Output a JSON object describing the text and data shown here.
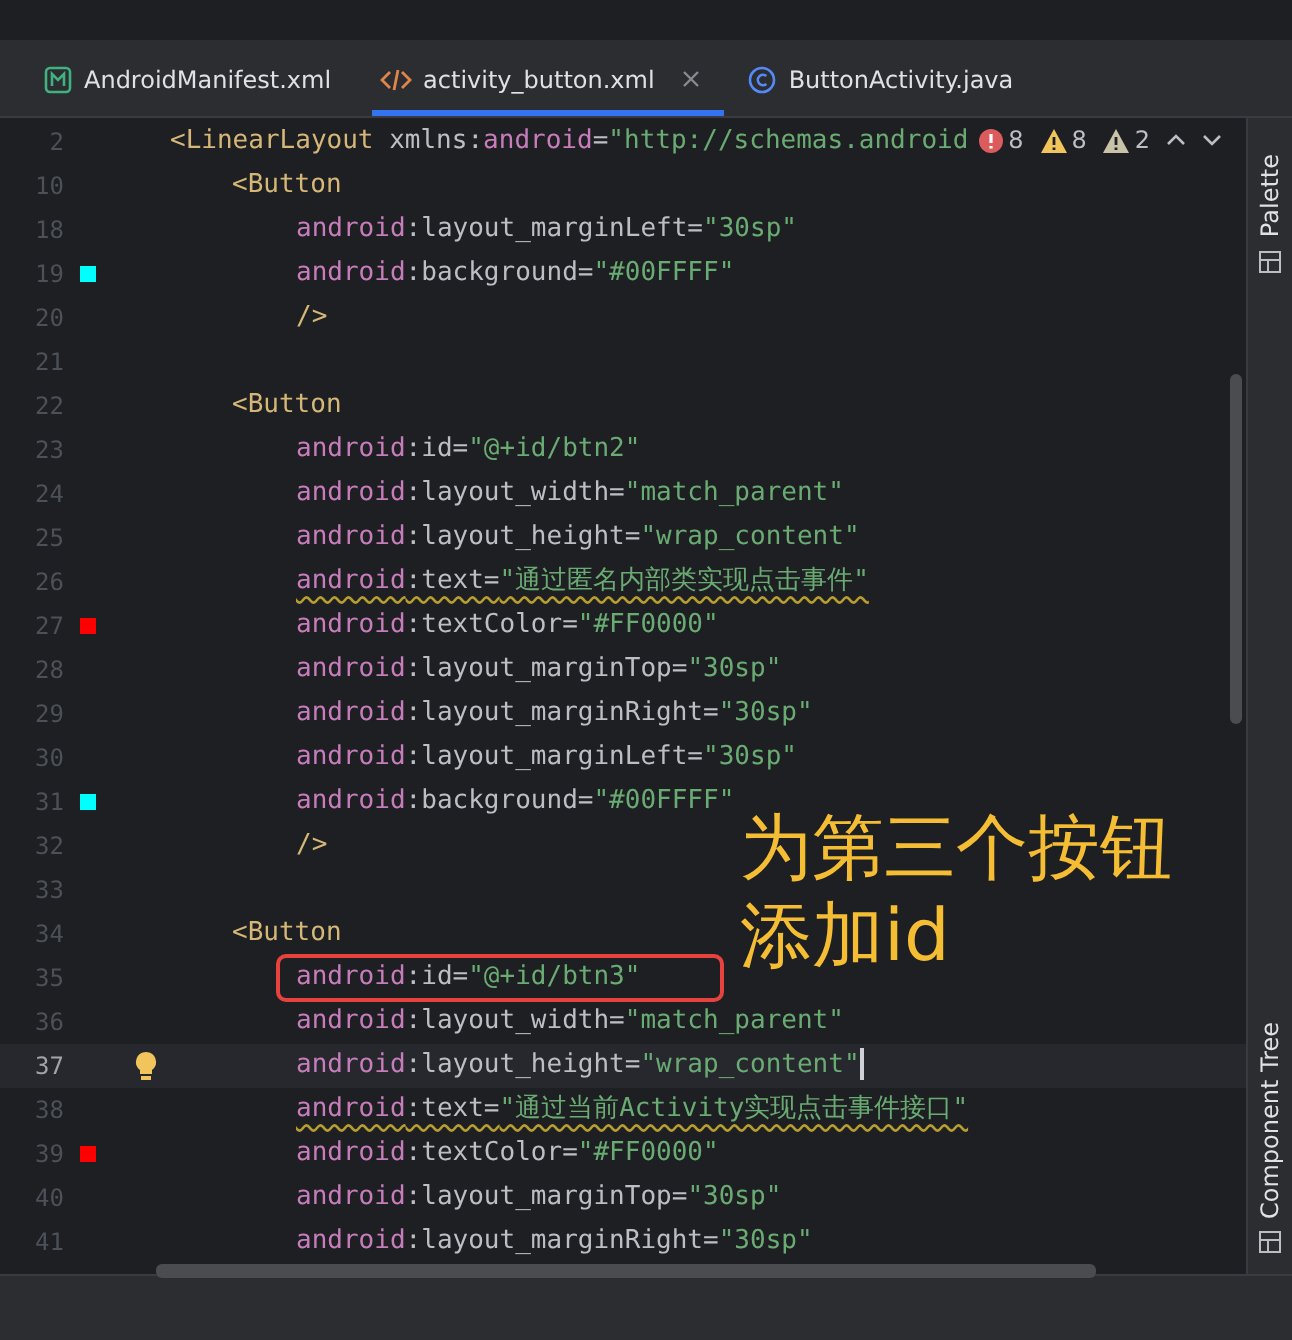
{
  "tabs": [
    {
      "label": "AndroidManifest.xml",
      "kind": "manifest",
      "selected": false,
      "closable": false
    },
    {
      "label": "activity_button.xml",
      "kind": "layout",
      "selected": true,
      "closable": true
    },
    {
      "label": "ButtonActivity.java",
      "kind": "class",
      "selected": false,
      "closable": false
    }
  ],
  "inspections": [
    {
      "kind": "error",
      "count": "8"
    },
    {
      "kind": "warning",
      "count": "8"
    },
    {
      "kind": "weak",
      "count": "2"
    }
  ],
  "lines": [
    {
      "num": "2",
      "kind": "root",
      "parts": [
        {
          "kind": "tag",
          "text": "<LinearLayout"
        },
        {
          "kind": "plain",
          "text": " xmlns:"
        },
        {
          "kind": "ns",
          "text": "android"
        },
        {
          "kind": "plain",
          "text": "="
        },
        {
          "kind": "str",
          "text": "\"http://schemas.android"
        }
      ]
    },
    {
      "num": "10",
      "kind": "element",
      "parts": [
        {
          "kind": "tag",
          "text": "<Button"
        }
      ]
    },
    {
      "num": "18",
      "kind": "attribute",
      "parts": [
        {
          "kind": "ns",
          "text": "android"
        },
        {
          "kind": "plain",
          "text": ":layout_marginLeft="
        },
        {
          "kind": "str",
          "text": "\"30sp\""
        }
      ]
    },
    {
      "num": "19",
      "kind": "attribute",
      "color": "#00ffff",
      "parts": [
        {
          "kind": "ns",
          "text": "android"
        },
        {
          "kind": "plain",
          "text": ":background="
        },
        {
          "kind": "str",
          "text": "\"#00FFFF\""
        }
      ]
    },
    {
      "num": "20",
      "kind": "attribute",
      "parts": [
        {
          "kind": "tag",
          "text": "/>"
        }
      ]
    },
    {
      "num": "21"
    },
    {
      "num": "22",
      "kind": "element",
      "parts": [
        {
          "kind": "tag",
          "text": "<Button"
        }
      ]
    },
    {
      "num": "23",
      "kind": "attribute",
      "parts": [
        {
          "kind": "ns",
          "text": "android"
        },
        {
          "kind": "plain",
          "text": ":id="
        },
        {
          "kind": "str",
          "text": "\"@+id/btn2\""
        }
      ]
    },
    {
      "num": "24",
      "kind": "attribute",
      "parts": [
        {
          "kind": "ns",
          "text": "android"
        },
        {
          "kind": "plain",
          "text": ":layout_width="
        },
        {
          "kind": "str",
          "text": "\"match_parent\""
        }
      ]
    },
    {
      "num": "25",
      "kind": "attribute",
      "parts": [
        {
          "kind": "ns",
          "text": "android"
        },
        {
          "kind": "plain",
          "text": ":layout_height="
        },
        {
          "kind": "str",
          "text": "\"wrap_content\""
        }
      ]
    },
    {
      "num": "26",
      "kind": "attribute",
      "squiggle": true,
      "parts": [
        {
          "kind": "ns",
          "text": "android"
        },
        {
          "kind": "plain",
          "text": ":text="
        },
        {
          "kind": "str",
          "text": "\"通过匿名内部类实现点击事件\""
        }
      ]
    },
    {
      "num": "27",
      "kind": "attribute",
      "color": "#ff0000",
      "parts": [
        {
          "kind": "ns",
          "text": "android"
        },
        {
          "kind": "plain",
          "text": ":textColor="
        },
        {
          "kind": "str",
          "text": "\"#FF0000\""
        }
      ]
    },
    {
      "num": "28",
      "kind": "attribute",
      "parts": [
        {
          "kind": "ns",
          "text": "android"
        },
        {
          "kind": "plain",
          "text": ":layout_marginTop="
        },
        {
          "kind": "str",
          "text": "\"30sp\""
        }
      ]
    },
    {
      "num": "29",
      "kind": "attribute",
      "parts": [
        {
          "kind": "ns",
          "text": "android"
        },
        {
          "kind": "plain",
          "text": ":layout_marginRight="
        },
        {
          "kind": "str",
          "text": "\"30sp\""
        }
      ]
    },
    {
      "num": "30",
      "kind": "attribute",
      "parts": [
        {
          "kind": "ns",
          "text": "android"
        },
        {
          "kind": "plain",
          "text": ":layout_marginLeft="
        },
        {
          "kind": "str",
          "text": "\"30sp\""
        }
      ]
    },
    {
      "num": "31",
      "kind": "attribute",
      "color": "#00ffff",
      "parts": [
        {
          "kind": "ns",
          "text": "android"
        },
        {
          "kind": "plain",
          "text": ":background="
        },
        {
          "kind": "str",
          "text": "\"#00FFFF\""
        }
      ]
    },
    {
      "num": "32",
      "kind": "attribute",
      "parts": [
        {
          "kind": "tag",
          "text": "/>"
        }
      ]
    },
    {
      "num": "33"
    },
    {
      "num": "34",
      "kind": "element",
      "parts": [
        {
          "kind": "tag",
          "text": "<Button"
        }
      ]
    },
    {
      "num": "35",
      "kind": "attribute",
      "boxed": true,
      "parts": [
        {
          "kind": "ns",
          "text": "android"
        },
        {
          "kind": "plain",
          "text": ":id="
        },
        {
          "kind": "str",
          "text": "\"@+id/btn3\""
        }
      ]
    },
    {
      "num": "36",
      "kind": "attribute",
      "parts": [
        {
          "kind": "ns",
          "text": "android"
        },
        {
          "kind": "plain",
          "text": ":layout_width="
        },
        {
          "kind": "str",
          "text": "\"match_parent\""
        }
      ]
    },
    {
      "num": "37",
      "kind": "attribute",
      "current": true,
      "bulb": true,
      "parts": [
        {
          "kind": "ns",
          "text": "android"
        },
        {
          "kind": "plain",
          "text": ":layout_height="
        },
        {
          "kind": "str",
          "text": "\"wrap_content\""
        }
      ]
    },
    {
      "num": "38",
      "kind": "attribute",
      "squiggle": true,
      "parts": [
        {
          "kind": "ns",
          "text": "android"
        },
        {
          "kind": "plain",
          "text": ":text="
        },
        {
          "kind": "str",
          "text": "\"通过当前Activity实现点击事件接口\""
        }
      ]
    },
    {
      "num": "39",
      "kind": "attribute",
      "color": "#ff0000",
      "parts": [
        {
          "kind": "ns",
          "text": "android"
        },
        {
          "kind": "plain",
          "text": ":textColor="
        },
        {
          "kind": "str",
          "text": "\"#FF0000\""
        }
      ]
    },
    {
      "num": "40",
      "kind": "attribute",
      "parts": [
        {
          "kind": "ns",
          "text": "android"
        },
        {
          "kind": "plain",
          "text": ":layout_marginTop="
        },
        {
          "kind": "str",
          "text": "\"30sp\""
        }
      ]
    },
    {
      "num": "41",
      "kind": "attribute",
      "parts": [
        {
          "kind": "ns",
          "text": "android"
        },
        {
          "kind": "plain",
          "text": ":layout_marginRight="
        },
        {
          "kind": "str",
          "text": "\"30sp\""
        }
      ]
    }
  ],
  "annotation": [
    "为第三个按钮",
    "添加id"
  ],
  "side_panels": [
    "Palette",
    "Component Tree"
  ]
}
